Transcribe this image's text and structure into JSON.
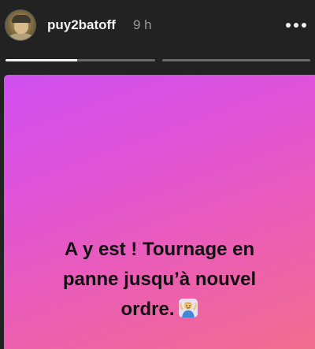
{
  "header": {
    "username": "puy2batoff",
    "timestamp": "9 h",
    "avatar_icon": "user-avatar-icon",
    "more_icon": "more-horizontal-icon"
  },
  "progress": [
    {
      "fill": 0.48
    },
    {
      "fill": 0.0
    }
  ],
  "story": {
    "lines": [
      "A y est ! Tournage en",
      "panne jusqu’à nouvel",
      "ordre."
    ],
    "emoji_icon": "person-shrugging-icon",
    "gradient": [
      "#cf4ff0",
      "#e154d6",
      "#ec5fae",
      "#f06e8e"
    ]
  },
  "colors": {
    "background": "#222222",
    "text_primary": "#f2f2f2",
    "text_secondary": "#9b9b9b",
    "progress_track": "#6a6a6a",
    "progress_fill": "#f4f4f4"
  }
}
